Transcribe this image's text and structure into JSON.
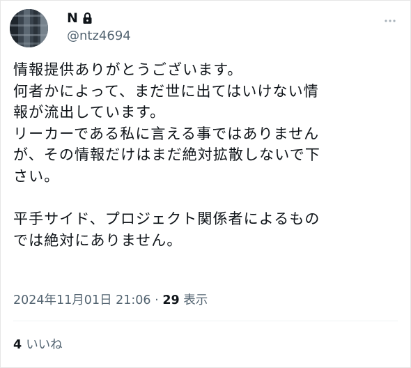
{
  "author": {
    "display_name": "N",
    "handle": "@ntz4694",
    "protected_icon": "lock-icon"
  },
  "tweet": {
    "lines": [
      "情報提供ありがとうございます。",
      "何者かによって、まだ世に出てはいけない情",
      "報が流出しています。",
      "リーカーである私に言える事ではありません",
      "が、その情報だけはまだ絶対拡散しないで下",
      "さい。",
      "",
      "平手サイド、プロジェクト関係者によるもの",
      "では絶対にありません。"
    ]
  },
  "meta": {
    "timestamp": "2024年11月01日 21:06",
    "separator": "·",
    "views_count": "29",
    "views_label": "表示"
  },
  "engagement": {
    "likes_count": "4",
    "likes_label": "いいね"
  },
  "icons": {
    "more": "more-icon",
    "lock": "lock-icon"
  },
  "colors": {
    "text": "#0f1419",
    "secondary": "#536471",
    "divider": "#eff3f4"
  }
}
